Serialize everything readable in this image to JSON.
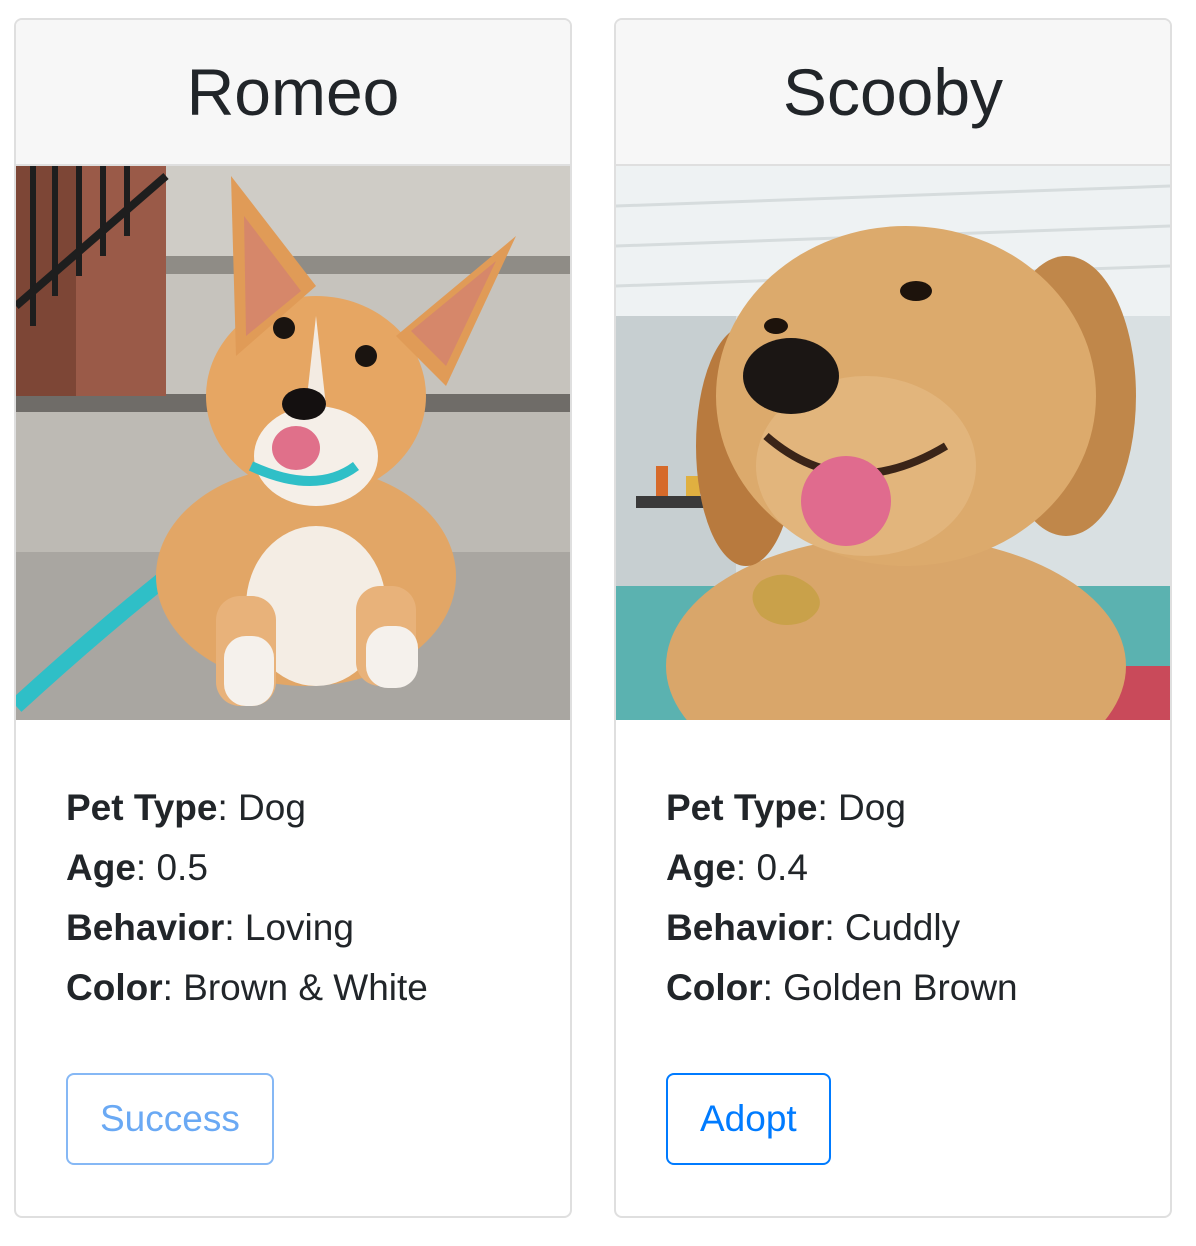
{
  "pets": [
    {
      "name": "Romeo",
      "fields": {
        "type_label": "Pet Type",
        "type_value": "Dog",
        "age_label": "Age",
        "age_value": "0.5",
        "behavior_label": "Behavior",
        "behavior_value": "Loving",
        "color_label": "Color",
        "color_value": "Brown & White"
      },
      "button_label": "Success",
      "button_state": "disabled"
    },
    {
      "name": "Scooby",
      "fields": {
        "type_label": "Pet Type",
        "type_value": "Dog",
        "age_label": "Age",
        "age_value": "0.4",
        "behavior_label": "Behavior",
        "behavior_value": "Cuddly",
        "color_label": "Color",
        "color_value": "Golden Brown"
      },
      "button_label": "Adopt",
      "button_state": "active"
    }
  ],
  "colors": {
    "accent": "#007bff",
    "accent_disabled": "#86b8f5",
    "header_bg": "#f7f7f7",
    "border": "#dfdfdf",
    "text": "#212529"
  }
}
